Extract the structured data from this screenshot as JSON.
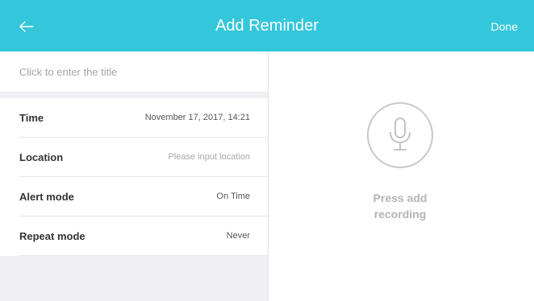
{
  "header": {
    "title": "Add Reminder",
    "back_icon": "back-arrow-icon",
    "done_label": "Done",
    "background_color": "#34c7db"
  },
  "form": {
    "title_placeholder": "Click to enter the title",
    "rows": [
      {
        "label": "Time",
        "value": "November 17, 2017, 14:21"
      },
      {
        "label": "Location",
        "value": "Please input location"
      },
      {
        "label": "Alert mode",
        "value": "On Time"
      },
      {
        "label": "Repeat mode",
        "value": "Never"
      }
    ]
  },
  "recording": {
    "icon": "microphone-icon",
    "prompt_line1": "Press add",
    "prompt_line2": "recording"
  }
}
